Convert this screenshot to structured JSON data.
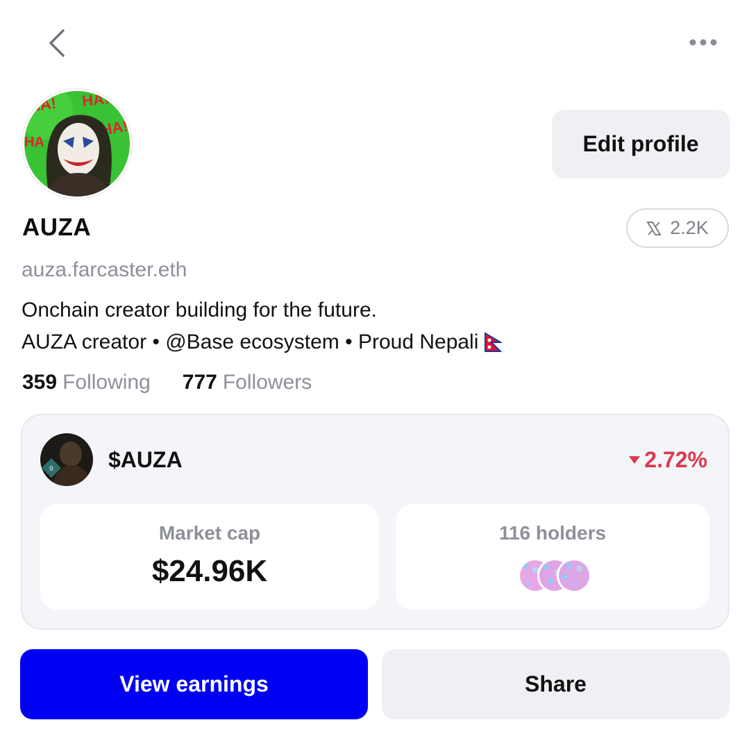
{
  "header": {
    "back_icon": "chevron-left-icon",
    "more_icon": "more-horizontal-icon"
  },
  "profile": {
    "edit_label": "Edit profile",
    "display_name": "AUZA",
    "x_followers": "2.2K",
    "handle": "auza.farcaster.eth",
    "bio_line1": "Onchain creator building for the future.",
    "bio_line2": "AUZA creator • @Base ecosystem • Proud Nepali",
    "following_count": "359",
    "following_label": "Following",
    "followers_count": "777",
    "followers_label": "Followers"
  },
  "token": {
    "ticker": "$AUZA",
    "change": "2.72%",
    "change_direction": "down",
    "market_cap_label": "Market cap",
    "market_cap_value": "$24.96K",
    "holders_label": "116 holders"
  },
  "actions": {
    "view_earnings_label": "View earnings",
    "share_label": "Share"
  },
  "colors": {
    "primary": "#0000f5",
    "negative": "#d93a51",
    "muted": "#8d9099",
    "surface": "#eff0f3"
  }
}
